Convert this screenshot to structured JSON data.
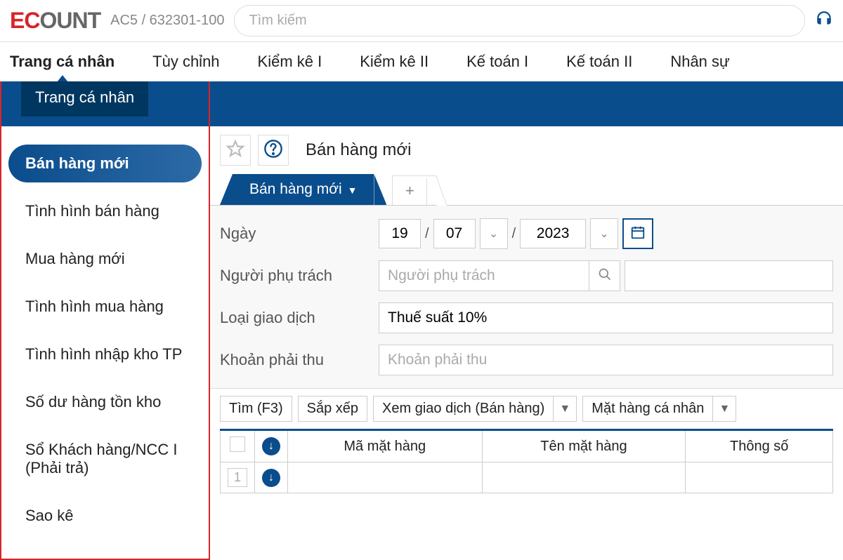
{
  "header": {
    "account_code": "AC5 / 632301-100",
    "search_placeholder": "Tìm kiếm"
  },
  "main_nav": {
    "items": [
      {
        "label": "Trang cá nhân",
        "active": true
      },
      {
        "label": "Tùy chỉnh"
      },
      {
        "label": "Kiểm kê I"
      },
      {
        "label": "Kiểm kê II"
      },
      {
        "label": "Kế toán I"
      },
      {
        "label": "Kế toán II"
      },
      {
        "label": "Nhân sự"
      }
    ]
  },
  "band": {
    "tab_label": "Trang cá nhân"
  },
  "sidebar": {
    "items": [
      {
        "label": "Bán hàng mới",
        "active": true
      },
      {
        "label": "Tình hình bán hàng"
      },
      {
        "label": "Mua hàng mới"
      },
      {
        "label": "Tình hình mua hàng"
      },
      {
        "label": "Tình hình nhập kho TP"
      },
      {
        "label": "Số dư hàng tồn kho"
      },
      {
        "label": "Sổ Khách hàng/NCC I (Phải trả)"
      },
      {
        "label": "Sao kê"
      }
    ]
  },
  "page": {
    "title": "Bán hàng mới",
    "tab_label": "Bán hàng mới"
  },
  "form": {
    "date_label": "Ngày",
    "day": "19",
    "month": "07",
    "year": "2023",
    "person_label": "Người phụ trách",
    "person_placeholder": "Người phụ trách",
    "type_label": "Loại giao dịch",
    "type_value": "Thuế suất 10%",
    "receivable_label": "Khoản phải thu",
    "receivable_placeholder": "Khoản phải thu"
  },
  "toolbar": {
    "find": "Tìm (F3)",
    "sort": "Sắp xếp",
    "view": "Xem giao dịch (Bán hàng)",
    "personal_item": "Mặt hàng cá nhân"
  },
  "table": {
    "headers": {
      "item_code": "Mã mặt hàng",
      "item_name": "Tên mặt hàng",
      "spec": "Thông số"
    },
    "row1_num": "1"
  }
}
